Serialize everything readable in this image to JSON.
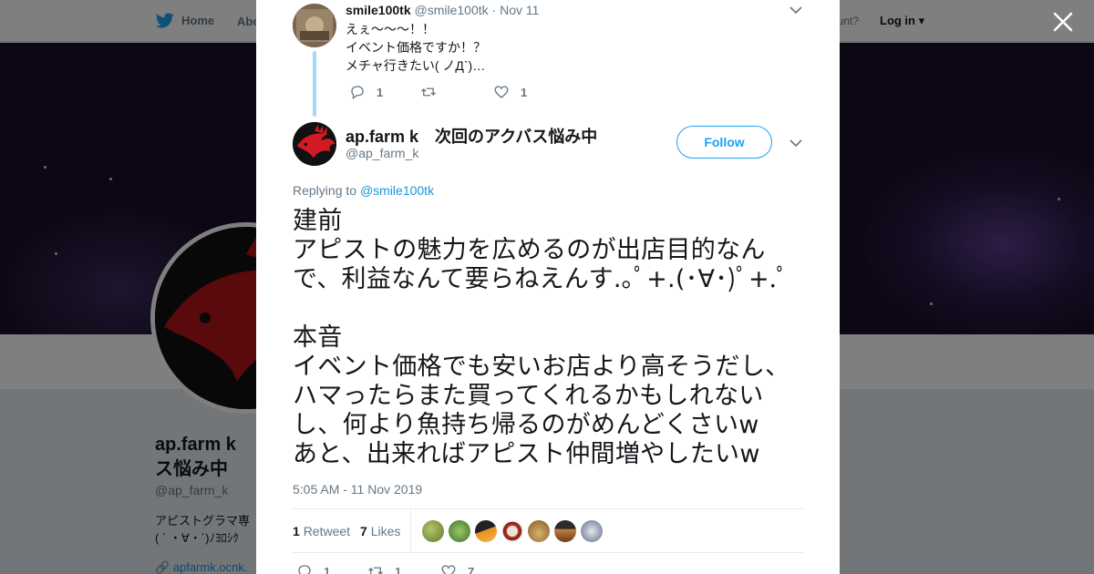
{
  "background": {
    "nav": {
      "home_label": "Home",
      "about_label": "Abo",
      "account_prompt": "ccount?",
      "login_label": "Log in"
    },
    "profile": {
      "name": "ap.farm k\nス悩み中",
      "handle": "@ap_farm_k",
      "bio": "アピストグラマ専\n( ` ・∀・´)ﾉﾖﾛｼｸ",
      "link": "apfarmk.ocnk."
    }
  },
  "modal": {
    "parent_tweet": {
      "name": "smile100tk",
      "handle": "@smile100tk",
      "separator": "·",
      "date": "Nov 11",
      "text": "えぇ～～～！！\nイベント価格ですか！？\nメチャ行きたい( ノД`)…",
      "reply_count": "1",
      "retweet_count": "",
      "like_count": "1"
    },
    "main_tweet": {
      "name": "ap.farm k　次回のアクバス悩み中",
      "handle": "@ap_farm_k",
      "follow_label": "Follow",
      "replying_to_label": "Replying to",
      "replying_to_handle": "@smile100tk",
      "text": "建前\nアピストの魅力を広めるのが出店目的なんで、利益なんて要らねえんす.｡ﾟ+.(･∀･)ﾟ+.ﾟ\n\n本音\nイベント価格でも安いお店より高そうだし、ハマったらまた買ってくれるかもしれないし、何より魚持ち帰るのがめんどくさいw\nあと、出来ればアピスト仲間増やしたいw",
      "timestamp": "5:05 AM - 11 Nov 2019",
      "retweets_count": "1",
      "retweets_label": "Retweet",
      "likes_count": "7",
      "likes_label": "Likes",
      "reply_count": "1",
      "retweet_count": "1",
      "like_count": "7"
    }
  },
  "colors": {
    "accent": "#1da1f2",
    "thread_line": "#a4d9f9",
    "text": "#14171a",
    "muted": "#657786"
  },
  "icons": [
    "twitter-bird-icon",
    "close-icon",
    "chevron-down-icon",
    "reply-icon",
    "retweet-icon",
    "heart-icon",
    "link-icon"
  ]
}
